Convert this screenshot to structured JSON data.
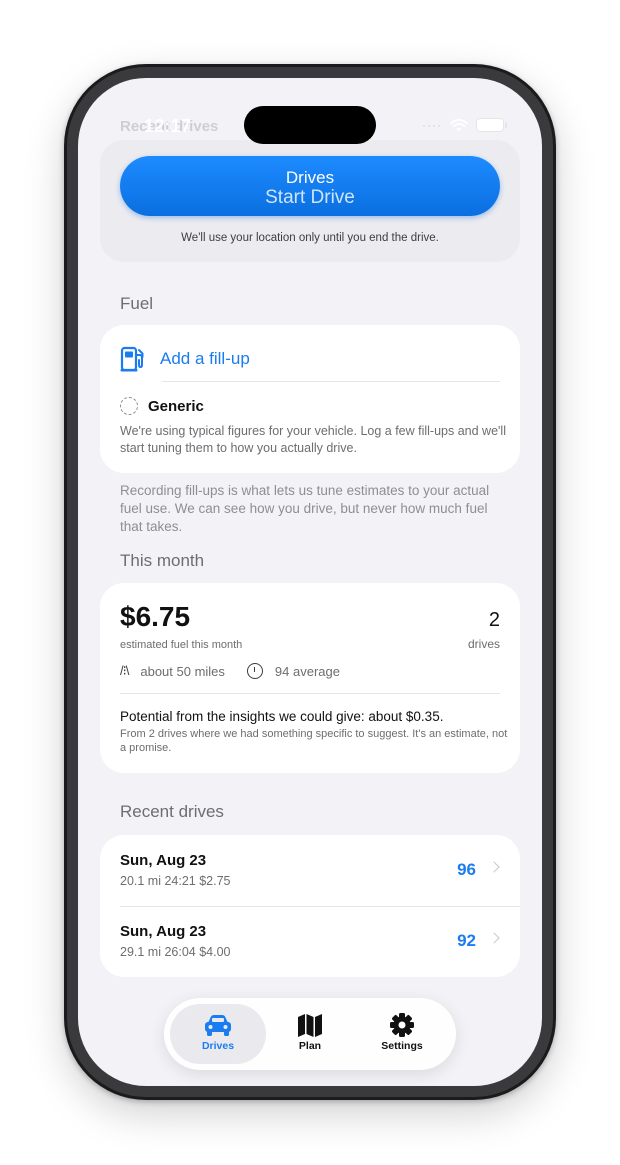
{
  "status": {
    "time": "12:17",
    "ghost_title": "Recent drives"
  },
  "top": {
    "nav_title": "Drives",
    "start_label": "Start Drive",
    "note": "We'll use your location only until you end the drive."
  },
  "fuel": {
    "section_title": "Fuel",
    "add_label": "Add a fill-up",
    "profile_label": "Generic",
    "profile_desc": "We're using typical figures for your vehicle. Log a few fill-ups and we'll start tuning them to how you actually drive.",
    "footnote": "Recording fill-ups is what lets us tune estimates to your actual fuel use. We can see how you drive, but never how much fuel that takes."
  },
  "month": {
    "section_title": "This month",
    "amount": "$6.75",
    "amount_label": "estimated fuel this month",
    "drives_count": "2",
    "drives_label": "drives",
    "distance": "about 50 miles",
    "average": "94 average",
    "potential_title": "Potential from the insights we could give: about $0.35.",
    "potential_sub": "From 2 drives where we had something specific to suggest. It's an estimate, not a promise."
  },
  "recent": {
    "section_title": "Recent drives",
    "drives": [
      {
        "date": "Sun, Aug 23",
        "meta": "20.1 mi  24:21  $2.75",
        "score": "96"
      },
      {
        "date": "Sun, Aug 23",
        "meta": "29.1 mi  26:04  $4.00",
        "score": "92"
      }
    ]
  },
  "tabs": [
    {
      "label": "Drives",
      "icon": "car-icon",
      "active": true
    },
    {
      "label": "Plan",
      "icon": "map-icon",
      "active": false
    },
    {
      "label": "Settings",
      "icon": "gear-icon",
      "active": false
    }
  ],
  "colors": {
    "accent": "#1a7cf0",
    "background": "#f2f2f7"
  }
}
